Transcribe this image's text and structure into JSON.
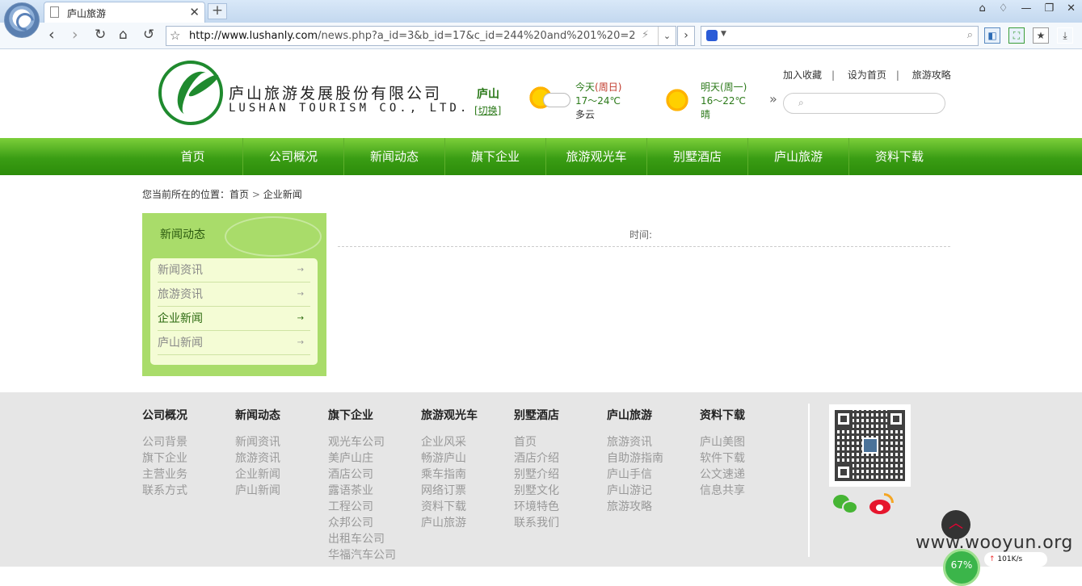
{
  "browser": {
    "tab_title": "庐山旅游",
    "url_prefix": "http://www.lushanly.com",
    "url_rest": "/news.php?a_id=3&b_id=17&c_id=244%20and%201%20=2"
  },
  "header": {
    "company_cn": "庐山旅游发展股份有限公司",
    "company_en": "LUSHAN TOURISM  CO., LTD.",
    "city": "庐山",
    "switch_label": "[切换]",
    "today": {
      "label": "今天",
      "weekday": "(周日)",
      "temp": "17～24℃",
      "desc": "多云"
    },
    "tomorrow": {
      "label": "明天(周一)",
      "temp": "16～22℃",
      "desc": "晴"
    },
    "links": [
      "加入收藏",
      "设为首页",
      "旅游攻略"
    ]
  },
  "nav": [
    "首页",
    "公司概况",
    "新闻动态",
    "旗下企业",
    "旅游观光车",
    "别墅酒店",
    "庐山旅游",
    "资料下载"
  ],
  "breadcrumb": {
    "prefix": "您当前所在的位置：",
    "home": "首页",
    "sep": ">",
    "current": "企业新闻"
  },
  "sidebar": {
    "title": "新闻动态",
    "items": [
      {
        "label": "新闻资讯",
        "active": false
      },
      {
        "label": "旅游资讯",
        "active": false
      },
      {
        "label": "企业新闻",
        "active": true
      },
      {
        "label": "庐山新闻",
        "active": false
      }
    ]
  },
  "content": {
    "time_label": "时间:"
  },
  "footer": {
    "columns": [
      {
        "title": "公司概况",
        "links": [
          "公司背景",
          "旗下企业",
          "主营业务",
          "联系方式"
        ]
      },
      {
        "title": "新闻动态",
        "links": [
          "新闻资讯",
          "旅游资讯",
          "企业新闻",
          "庐山新闻"
        ]
      },
      {
        "title": "旗下企业",
        "links": [
          "观光车公司",
          "美庐山庄",
          "酒店公司",
          "露语茶业",
          "工程公司",
          "众邦公司",
          "出租车公司",
          "华福汽车公司"
        ]
      },
      {
        "title": "旅游观光车",
        "links": [
          "企业风采",
          "畅游庐山",
          "乘车指南",
          "网络订票",
          "资料下载",
          "庐山旅游"
        ]
      },
      {
        "title": "别墅酒店",
        "links": [
          "首页",
          "酒店介绍",
          "别墅介绍",
          "别墅文化",
          "环境特色",
          "联系我们"
        ]
      },
      {
        "title": "庐山旅游",
        "links": [
          "旅游资讯",
          "自助游指南",
          "庐山手信",
          "庐山游记",
          "旅游攻略"
        ]
      },
      {
        "title": "资料下载",
        "links": [
          "庐山美图",
          "软件下载",
          "公文速递",
          "信息共享"
        ]
      }
    ]
  },
  "overlay": {
    "watermark": "www.wooyun.org",
    "meter": "67%",
    "speed": "101K/s"
  }
}
